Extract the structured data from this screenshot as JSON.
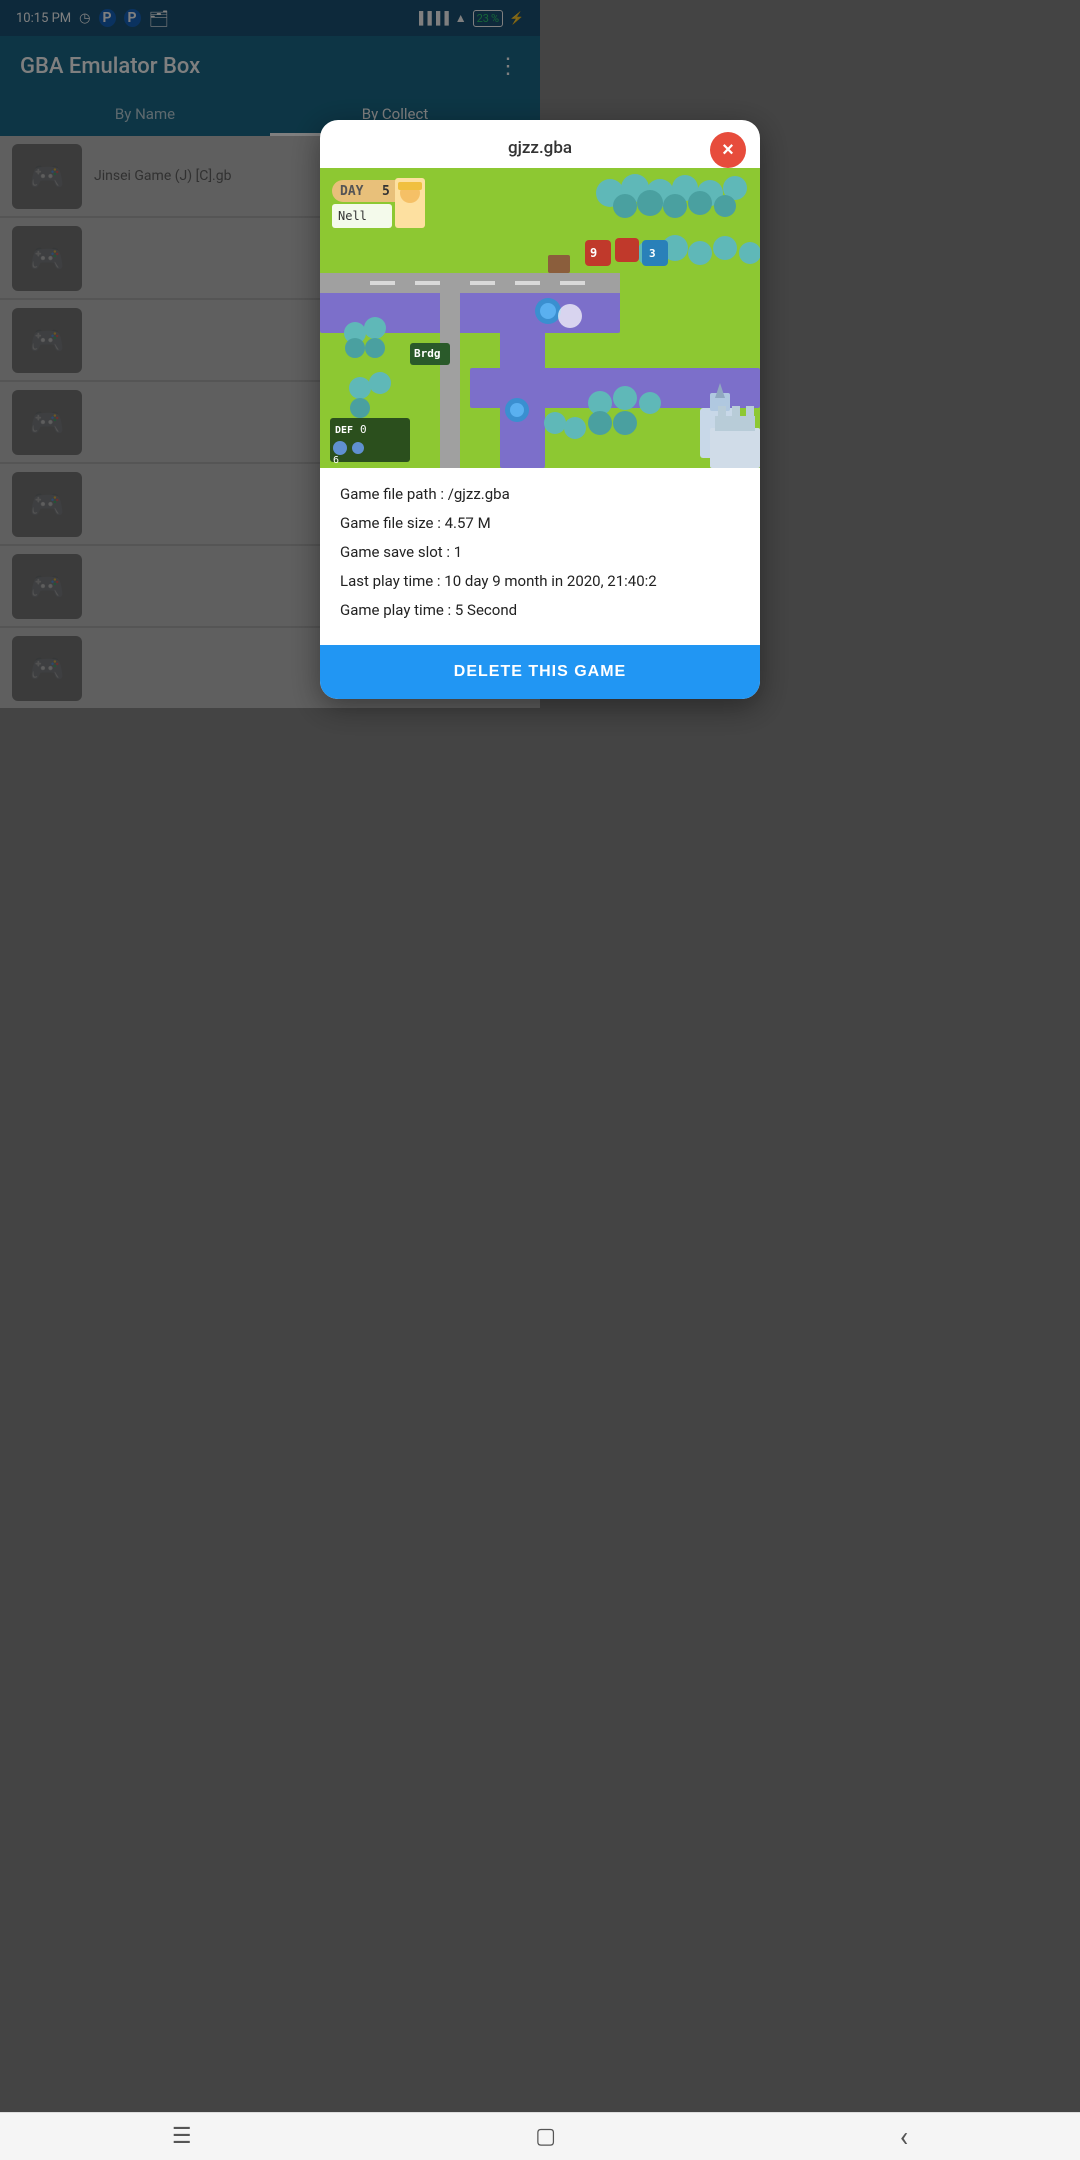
{
  "status_bar": {
    "time": "10:15 PM",
    "battery_pct": "23"
  },
  "header": {
    "title": "GBA Emulator Box",
    "menu_icon": "⋮",
    "tabs": [
      {
        "label": "By Name",
        "active": false
      },
      {
        "label": "By Collect",
        "active": true
      }
    ]
  },
  "list_rows": [
    {
      "title": "Jinsei Game (J) [C].gb"
    },
    {
      "title": ""
    },
    {
      "title": ""
    },
    {
      "title": ""
    },
    {
      "title": ""
    },
    {
      "title": ""
    },
    {
      "title": ""
    }
  ],
  "dialog": {
    "title": "gjzz.gba",
    "close_label": "×",
    "info": {
      "file_path_label": "Game file path :",
      "file_path_value": "/gjzz.gba",
      "file_size_label": "Game file size :",
      "file_size_value": "4.57 M",
      "save_slot_label": "Game save slot :",
      "save_slot_value": "1",
      "last_play_label": "Last play time :",
      "last_play_value": "10 day 9 month in 2020, 21:40:2",
      "play_time_label": "Game play time :",
      "play_time_value": "5 Second"
    },
    "delete_button_label": "DELETE THIS GAME"
  },
  "nav_bar": {
    "menu_icon": "☰",
    "home_icon": "▢",
    "back_icon": "‹"
  }
}
